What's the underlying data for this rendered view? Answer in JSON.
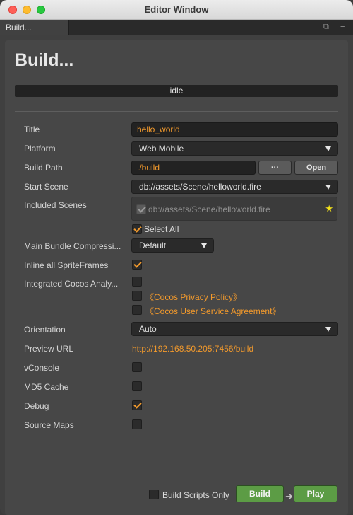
{
  "window": {
    "title": "Editor Window"
  },
  "tab": {
    "label": "Build...",
    "icons": [
      "popout-icon",
      "menu-icon"
    ]
  },
  "heading": "Build...",
  "status": "idle",
  "form": {
    "title": {
      "label": "Title",
      "value": "hello_world"
    },
    "platform": {
      "label": "Platform",
      "value": "Web Mobile"
    },
    "build_path": {
      "label": "Build Path",
      "value": "./build",
      "browse_label": "···",
      "open_label": "Open"
    },
    "start_scene": {
      "label": "Start Scene",
      "value": "db://assets/Scene/helloworld.fire"
    },
    "included_scenes": {
      "label": "Included Scenes",
      "items": [
        "db://assets/Scene/helloworld.fire"
      ],
      "select_all_label": "Select All",
      "select_all_checked": true
    },
    "main_bundle_compression": {
      "label": "Main Bundle Compressi...",
      "value": "Default"
    },
    "inline_sprite_frames": {
      "label": "Inline all SpriteFrames",
      "checked": true
    },
    "integrated_analytics": {
      "label": "Integrated Cocos Analy...",
      "checked": false,
      "privacy_policy": "《Cocos Privacy Policy》",
      "privacy_checked": false,
      "user_agreement": "《Cocos User Service Agreement》",
      "agreement_checked": false
    },
    "orientation": {
      "label": "Orientation",
      "value": "Auto"
    },
    "preview_url": {
      "label": "Preview URL",
      "value": "http://192.168.50.205:7456/build"
    },
    "vconsole": {
      "label": "vConsole",
      "checked": false
    },
    "md5_cache": {
      "label": "MD5 Cache",
      "checked": false
    },
    "debug": {
      "label": "Debug",
      "checked": true
    },
    "source_maps": {
      "label": "Source Maps",
      "checked": false
    }
  },
  "footer": {
    "build_scripts_only_label": "Build Scripts Only",
    "build_scripts_only_checked": false,
    "build_label": "Build",
    "play_label": "Play"
  },
  "colors": {
    "accent": "#f39a2c",
    "button_green": "#5c9c45",
    "panel_bg": "#474747"
  }
}
